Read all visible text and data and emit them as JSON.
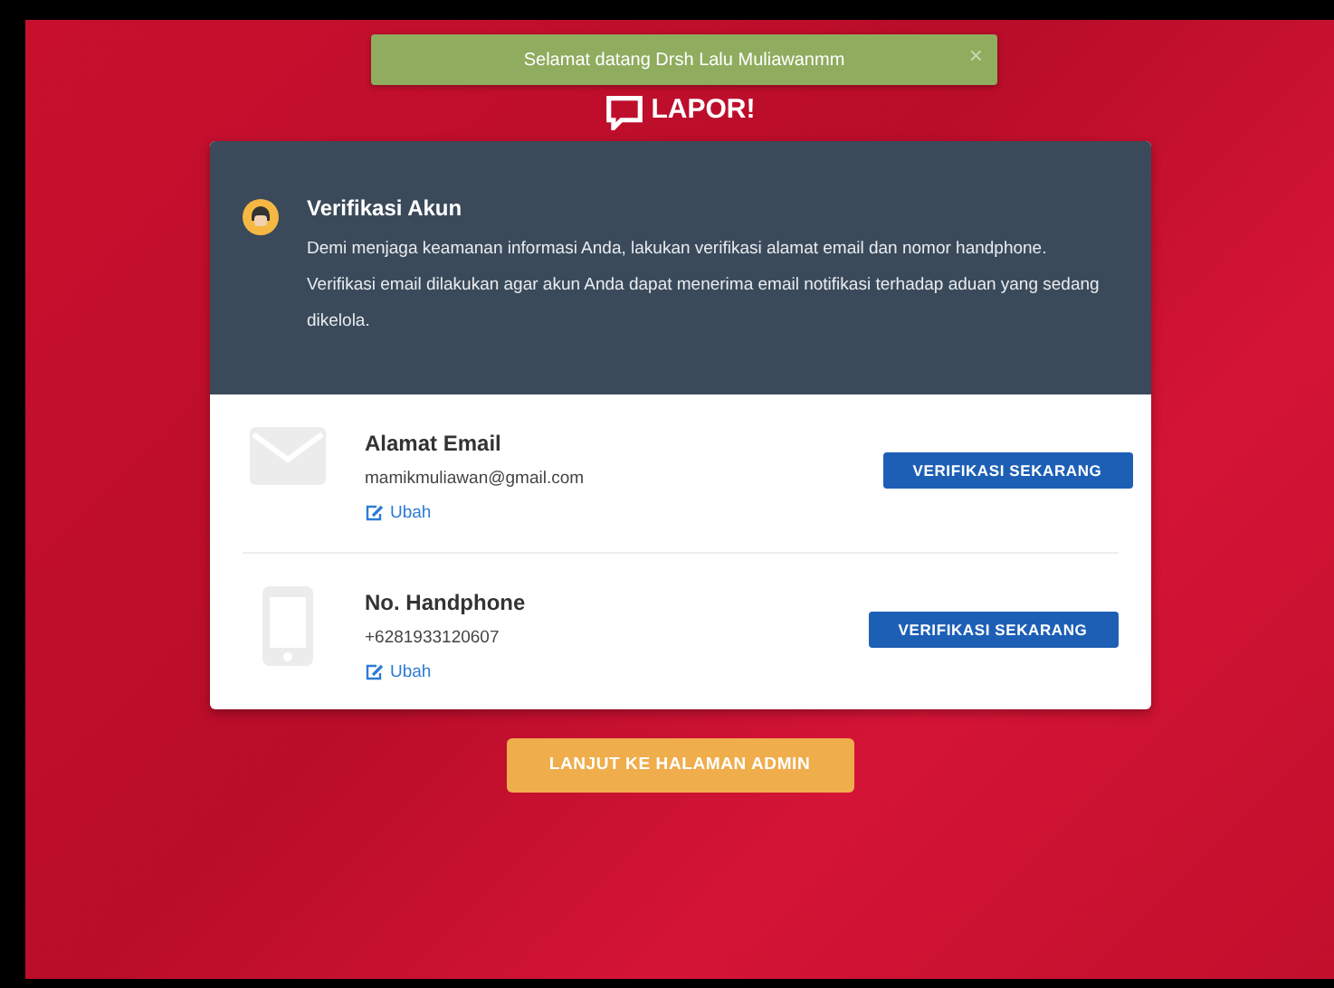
{
  "toast": {
    "message": "Selamat datang Drsh Lalu Muliawanmm",
    "close": "×"
  },
  "logo": {
    "text": "LAPOR!"
  },
  "verification": {
    "title": "Verifikasi Akun",
    "description": "Demi menjaga keamanan informasi Anda, lakukan verifikasi alamat email dan nomor handphone. Verifikasi email dilakukan agar akun Anda dapat menerima email notifikasi terhadap aduan yang sedang dikelola."
  },
  "items": [
    {
      "kind": "email",
      "label": "Alamat Email",
      "value": "mamikmuliawan@gmail.com",
      "edit": "Ubah",
      "button": "VERIFIKASI SEKARANG"
    },
    {
      "kind": "phone",
      "label": "No. Handphone",
      "value": "+6281933120607",
      "edit": "Ubah",
      "button": "VERIFIKASI SEKARANG"
    }
  ],
  "continue_button": "LANJUT KE HALAMAN ADMIN"
}
